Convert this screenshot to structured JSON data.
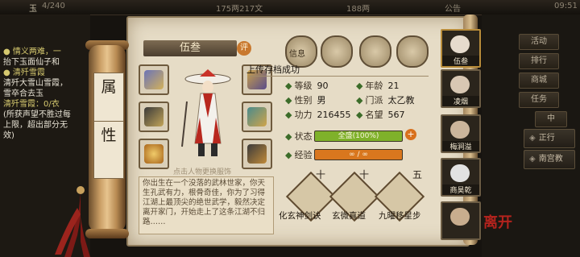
{
  "status_bar": {
    "left_label": "玉",
    "energy": "4/240",
    "coins": "175两217文",
    "gold": "188两",
    "notice": "公告",
    "time": "09:51"
  },
  "chat": {
    "lines": [
      {
        "text": "● 情义两难，一",
        "color": "#d6c96f"
      },
      {
        "text": "抬下玉面仙子和",
        "color": "#e8e3d5"
      },
      {
        "text": "● 清歼雪霞",
        "color": "#d6c96f"
      },
      {
        "text": "清歼大雪山雪霞，",
        "color": "#e8e3d5"
      },
      {
        "text": "雪卒合去玉",
        "color": "#e8e3d5"
      },
      {
        "text": "清歼雪霞：0/衣",
        "color": "#d6c96f"
      },
      {
        "text": "(所获声望不胜过每",
        "color": "#e8e3d5"
      },
      {
        "text": "上限，超出部分无",
        "color": "#e8e3d5"
      },
      {
        "text": "效)",
        "color": "#e8e3d5"
      }
    ]
  },
  "scroll": {
    "label_top": "属",
    "label_bottom": "性"
  },
  "character": {
    "name": "伍叁",
    "rate_badge": "评",
    "equip_hint": "点击人物更换服饰",
    "title": "上传存档成功",
    "description": "你出生在一个没落的武林世家，你天生孔武有力，根骨奇佳，你为了习得江湖上最顶尖的绝世武学，毅然决定离开家门，开始走上了这条江湖不归路……"
  },
  "tabs": [
    {
      "label": "信息"
    },
    {
      "label": ""
    },
    {
      "label": ""
    },
    {
      "label": ""
    }
  ],
  "stats": {
    "level_label": "等级",
    "level": "90",
    "age_label": "年龄",
    "age": "21",
    "gender_label": "性别",
    "gender": "男",
    "sect_label": "门派",
    "sect": "太乙教",
    "power_label": "功力",
    "power": "216455",
    "fame_label": "名望",
    "fame": "567",
    "state_label": "状态",
    "state_text": "全盛(100%)",
    "state_ratio": 1.0,
    "exp_label": "经验",
    "exp_text": "∞ / ∞",
    "exp_ratio": 1.0
  },
  "skills": [
    {
      "name": "化玄神剑诀",
      "rank": "十"
    },
    {
      "name": "玄微真道",
      "rank": "十"
    },
    {
      "name": "九曜移星步",
      "rank": "五"
    }
  ],
  "right_menu": {
    "buttons": [
      "活动",
      "排行",
      "商城",
      "任务"
    ],
    "sub_items": [
      "正行",
      "南宫教"
    ],
    "mid_label": "中",
    "exit_label": "离开"
  },
  "party": [
    {
      "name": "伍叁"
    },
    {
      "name": "凌烟"
    },
    {
      "name": "梅涧溢"
    },
    {
      "name": "商昊乾"
    },
    {
      "name": ""
    }
  ],
  "colors": {
    "state_fill": "#7fb12a",
    "exp_fill": "#d9771e",
    "accent_red": "#b3231d"
  }
}
